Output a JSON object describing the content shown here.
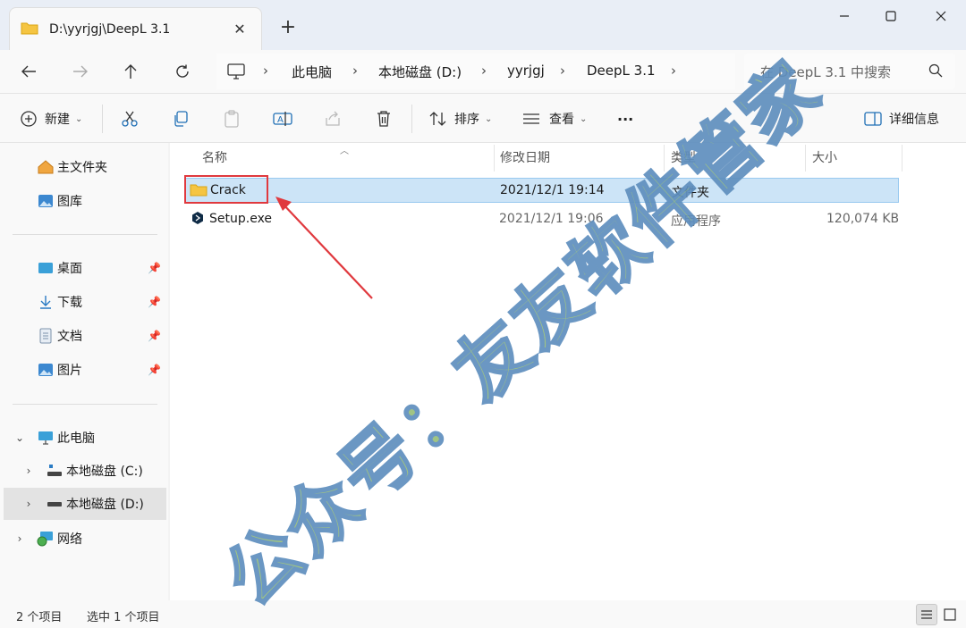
{
  "window": {
    "tab_title": "D:\\yyrjgj\\DeepL 3.1",
    "new_tab": "+"
  },
  "address": {
    "crumbs": [
      "此电脑",
      "本地磁盘 (D:)",
      "yyrjgj",
      "DeepL 3.1"
    ],
    "search_placeholder": "在 DeepL 3.1 中搜索"
  },
  "toolbar": {
    "new_label": "新建",
    "sort_label": "排序",
    "view_label": "查看",
    "more_label": "···",
    "details_label": "详细信息"
  },
  "sidebar": {
    "quick": [
      {
        "label": "主文件夹",
        "icon": "home-icon"
      },
      {
        "label": "图库",
        "icon": "gallery-icon"
      }
    ],
    "pinned": [
      {
        "label": "桌面",
        "icon": "desktop-icon"
      },
      {
        "label": "下载",
        "icon": "download-icon"
      },
      {
        "label": "文档",
        "icon": "document-icon"
      },
      {
        "label": "图片",
        "icon": "pictures-icon"
      }
    ],
    "this_pc": "此电脑",
    "drives": [
      "本地磁盘 (C:)",
      "本地磁盘 (D:)"
    ],
    "network": "网络"
  },
  "columns": {
    "name": "名称",
    "date": "修改日期",
    "type": "类型",
    "size": "大小"
  },
  "files": [
    {
      "name": "Crack",
      "date": "2021/12/1 19:14",
      "type": "文件夹",
      "size": "",
      "selected": true
    },
    {
      "name": "Setup.exe",
      "date": "2021/12/1 19:06",
      "type": "应用程序",
      "size": "120,074 KB",
      "selected": false
    }
  ],
  "status": {
    "count": "2 个项目",
    "selected": "选中 1 个项目"
  },
  "watermark": "公众号：友友软件管家",
  "colors": {
    "accent": "#0067c0",
    "selection": "#cce4f7",
    "highlight_box": "#e0393e",
    "watermark_fill": "#98bf7a",
    "watermark_stroke": "#5f8fbe"
  }
}
